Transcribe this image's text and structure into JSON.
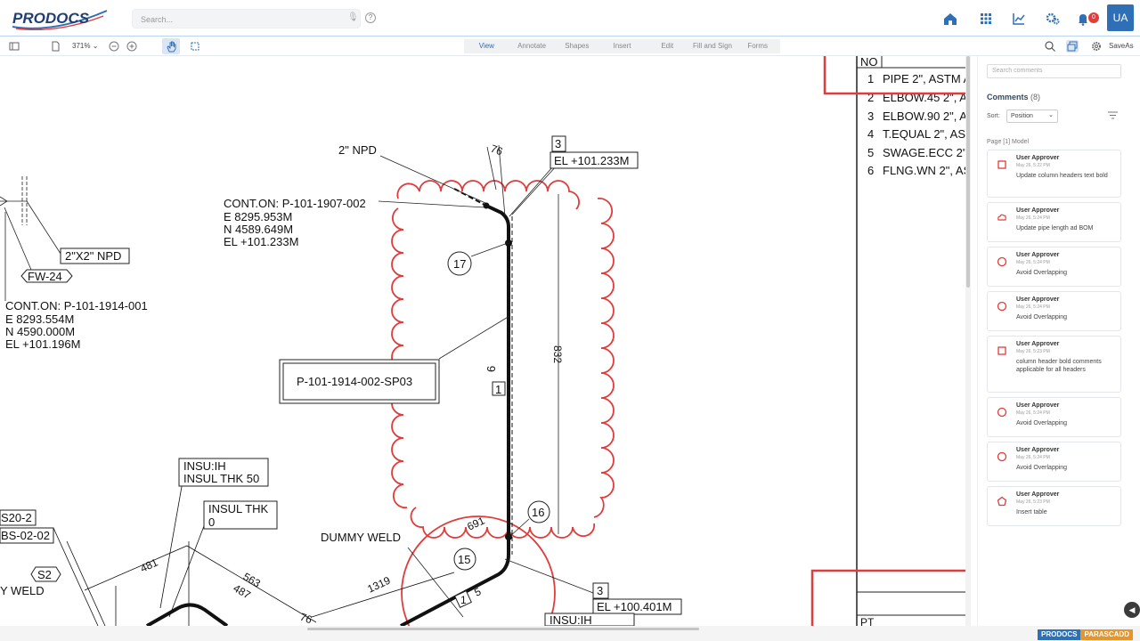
{
  "header": {
    "logo_text": "PRODOCS",
    "search_placeholder": "Search...",
    "help": "?",
    "avatar": "UA",
    "notification_count": "0",
    "nav_icons": [
      "home-icon",
      "apps-grid-icon",
      "analytics-icon",
      "settings-gears-icon",
      "bell-icon"
    ]
  },
  "toolbar": {
    "zoom": "371%",
    "tabs": [
      "View",
      "Annotate",
      "Shapes",
      "Insert",
      "Edit",
      "Fill and Sign",
      "Forms"
    ],
    "active_tab": "View",
    "save_as": "SaveAs"
  },
  "drawing": {
    "bom_header": "NO",
    "bom_rows": [
      {
        "no": "1",
        "desc": "PIPE 2\", ASTM A"
      },
      {
        "no": "2",
        "desc": "ELBOW.45 2\", A"
      },
      {
        "no": "3",
        "desc": "ELBOW.90 2\", A"
      },
      {
        "no": "4",
        "desc": "T.EQUAL 2\", AST"
      },
      {
        "no": "5",
        "desc": "SWAGE.ECC 2\""
      },
      {
        "no": "6",
        "desc": "FLNG.WN 2\", AS"
      }
    ],
    "bottom_table_label": "PT",
    "labels": {
      "npd": "2\" NPD",
      "dim_76_top": "76",
      "tag_3_top": "3",
      "el_top": "EL +101.233M",
      "cont1_l1": "CONT.ON: P-101-1907-002",
      "cont1_l2": "E 8295.953M",
      "cont1_l3": "N 4589.649M",
      "cont1_l4": "EL +101.233M",
      "npd2": "2\"X2\" NPD",
      "fw": "FW-24",
      "cont2_l1": "CONT.ON: P-101-1914-001",
      "cont2_l2": "E 8293.554M",
      "cont2_l3": "N 4590.000M",
      "cont2_l4": "EL +101.196M",
      "spool": "P-101-1914-002-SP03",
      "bubble_17": "17",
      "bubble_16": "16",
      "bubble_15": "15",
      "dim_832": "832",
      "dim_6": "6",
      "dim_1": "1",
      "insu1_l1": "INSU:IH",
      "insu1_l2": "INSUL THK 50",
      "insu2_l1": "INSUL THK",
      "insu2_l2": "0",
      "s20": "S20-2",
      "bs": "BS-02-02",
      "s2": "S2",
      "weld_left": "Y WELD",
      "dummy_weld": "DUMMY WELD",
      "dim_481": "481",
      "dim_563": "563",
      "dim_487": "487",
      "dim_1319": "1319",
      "dim_76_bottom": "76",
      "dim_691": "691",
      "dim_5": "5",
      "dim_1b": "1",
      "tag_3_bottom": "3",
      "el_bottom": "EL +100.401M",
      "insu_bottom": "INSU:IH"
    }
  },
  "comments_panel": {
    "search_placeholder": "Search comments",
    "title": "Comments",
    "count": "(8)",
    "sort_label": "Sort:",
    "sort_value": "Position",
    "page_label": "Page [1] Model",
    "comments": [
      {
        "user": "User Approver",
        "date": "May 26, 5:22 PM",
        "text": "Update column headers text bold",
        "icon": "square-annotation-icon"
      },
      {
        "user": "User Approver",
        "date": "May 26, 5:24 PM",
        "text": "Update pipe length ad BOM",
        "icon": "cloud-annotation-icon"
      },
      {
        "user": "User Approver",
        "date": "May 26, 5:24 PM",
        "text": "Avoid Overlapping",
        "icon": "circle-annotation-icon"
      },
      {
        "user": "User Approver",
        "date": "May 26, 5:24 PM",
        "text": "Avoid Overlapping",
        "icon": "circle-annotation-icon"
      },
      {
        "user": "User Approver",
        "date": "May 26, 5:23 PM",
        "text": "column header bold comments applicable for all headers",
        "icon": "square-annotation-icon"
      },
      {
        "user": "User Approver",
        "date": "May 26, 5:24 PM",
        "text": "Avoid Overlapping",
        "icon": "circle-annotation-icon"
      },
      {
        "user": "User Approver",
        "date": "May 26, 5:24 PM",
        "text": "Avoid Overlapping",
        "icon": "circle-annotation-icon"
      },
      {
        "user": "User Approver",
        "date": "May 26, 5:23 PM",
        "text": "Insert table",
        "icon": "polygon-annotation-icon"
      }
    ]
  },
  "footer": {
    "brand_a": "PRODOCS",
    "brand_b": "PARASCADD"
  },
  "colors": {
    "accent": "#2f6fb6",
    "markup_red": "#e03c3c",
    "badge_red": "#e23d3d",
    "brand_orange": "#e3962f"
  }
}
